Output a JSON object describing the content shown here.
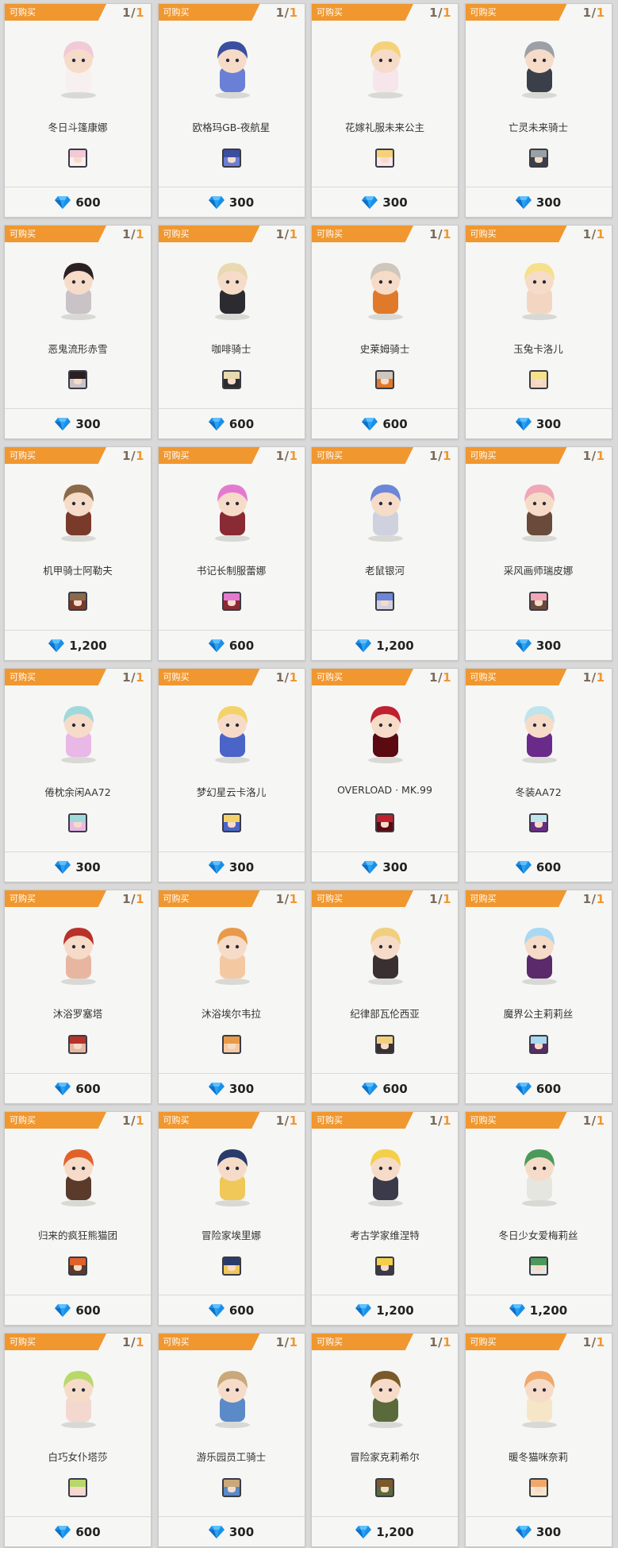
{
  "shop": {
    "tag_label": "可购买",
    "gem_icon": "diamond-icon",
    "gem_color": "#1a8fe8",
    "tag_color": "#f0972f",
    "items": [
      {
        "name": "冬日斗篷康娜",
        "price": "600",
        "count": "1",
        "max": "1",
        "hair": "#f2c9d8",
        "body": "#f7f0ef"
      },
      {
        "name": "欧格玛GB-夜航星",
        "price": "300",
        "count": "1",
        "max": "1",
        "hair": "#3b4fa0",
        "body": "#6a7fd6"
      },
      {
        "name": "花嫁礼服未来公主",
        "price": "300",
        "count": "1",
        "max": "1",
        "hair": "#f5d27a",
        "body": "#f6e6ec"
      },
      {
        "name": "亡灵未来骑士",
        "price": "300",
        "count": "1",
        "max": "1",
        "hair": "#9aa0a6",
        "body": "#3a3f4a"
      },
      {
        "name": "恶鬼流形赤雪",
        "price": "300",
        "count": "1",
        "max": "1",
        "hair": "#2a2024",
        "body": "#c9c3c8"
      },
      {
        "name": "咖啡骑士",
        "price": "600",
        "count": "1",
        "max": "1",
        "hair": "#e8d9b0",
        "body": "#2c2c30"
      },
      {
        "name": "史莱姆骑士",
        "price": "600",
        "count": "1",
        "max": "1",
        "hair": "#cfc6bc",
        "body": "#e07a2a"
      },
      {
        "name": "玉兔卡洛儿",
        "price": "300",
        "count": "1",
        "max": "1",
        "hair": "#f6e08a",
        "body": "#f3d6c2"
      },
      {
        "name": "机甲骑士阿勒夫",
        "price": "1,200",
        "count": "1",
        "max": "1",
        "hair": "#8a6a4a",
        "body": "#7a3a2a"
      },
      {
        "name": "书记长制服蕾娜",
        "price": "600",
        "count": "1",
        "max": "1",
        "hair": "#e47ad0",
        "body": "#8a2a34"
      },
      {
        "name": "老鼠银河",
        "price": "1,200",
        "count": "1",
        "max": "1",
        "hair": "#6c86d8",
        "body": "#cfd2de"
      },
      {
        "name": "采风画师瑞皮娜",
        "price": "300",
        "count": "1",
        "max": "1",
        "hair": "#f1a8b6",
        "body": "#6a4a3a"
      },
      {
        "name": "倦枕余闲AA72",
        "price": "300",
        "count": "1",
        "max": "1",
        "hair": "#9fd9dc",
        "body": "#e9b8e6"
      },
      {
        "name": "梦幻星云卡洛儿",
        "price": "300",
        "count": "1",
        "max": "1",
        "hair": "#f3d26a",
        "body": "#4a64c8"
      },
      {
        "name": "OVERLOAD · MK.99",
        "price": "300",
        "count": "1",
        "max": "1",
        "hair": "#c02030",
        "body": "#5a0a10"
      },
      {
        "name": "冬装AA72",
        "price": "600",
        "count": "1",
        "max": "1",
        "hair": "#bfe4ec",
        "body": "#6a2a8a"
      },
      {
        "name": "沐浴罗塞塔",
        "price": "600",
        "count": "1",
        "max": "1",
        "hair": "#b8322a",
        "body": "#e8b6a0"
      },
      {
        "name": "沐浴埃尔韦拉",
        "price": "300",
        "count": "1",
        "max": "1",
        "hair": "#e89a4a",
        "body": "#f4c9a2"
      },
      {
        "name": "纪律部瓦伦西亚",
        "price": "600",
        "count": "1",
        "max": "1",
        "hair": "#f1cf7e",
        "body": "#3a3030"
      },
      {
        "name": "魔界公主莉莉丝",
        "price": "600",
        "count": "1",
        "max": "1",
        "hair": "#a8d8f2",
        "body": "#5a2a6a"
      },
      {
        "name": "归来的疯狂熊猫团",
        "price": "600",
        "count": "1",
        "max": "1",
        "hair": "#e0622a",
        "body": "#5a3a2a"
      },
      {
        "name": "冒险家埃里娜",
        "price": "600",
        "count": "1",
        "max": "1",
        "hair": "#2a3a6a",
        "body": "#f0c85a"
      },
      {
        "name": "考古学家维涅特",
        "price": "1,200",
        "count": "1",
        "max": "1",
        "hair": "#f3cf4a",
        "body": "#3a3a4a"
      },
      {
        "name": "冬日少女爱梅莉丝",
        "price": "1,200",
        "count": "1",
        "max": "1",
        "hair": "#4a9a5a",
        "body": "#e6e6e0"
      },
      {
        "name": "白巧女仆塔莎",
        "price": "600",
        "count": "1",
        "max": "1",
        "hair": "#b8d86a",
        "body": "#f3d8d0"
      },
      {
        "name": "游乐园员工骑士",
        "price": "300",
        "count": "1",
        "max": "1",
        "hair": "#c9a87a",
        "body": "#5a8ac8"
      },
      {
        "name": "冒险家克莉希尔",
        "price": "1,200",
        "count": "1",
        "max": "1",
        "hair": "#7a5a2a",
        "body": "#5a6a3a"
      },
      {
        "name": "暖冬猫咪奈莉",
        "price": "300",
        "count": "1",
        "max": "1",
        "hair": "#f0a86a",
        "body": "#f6e6c8"
      }
    ]
  }
}
